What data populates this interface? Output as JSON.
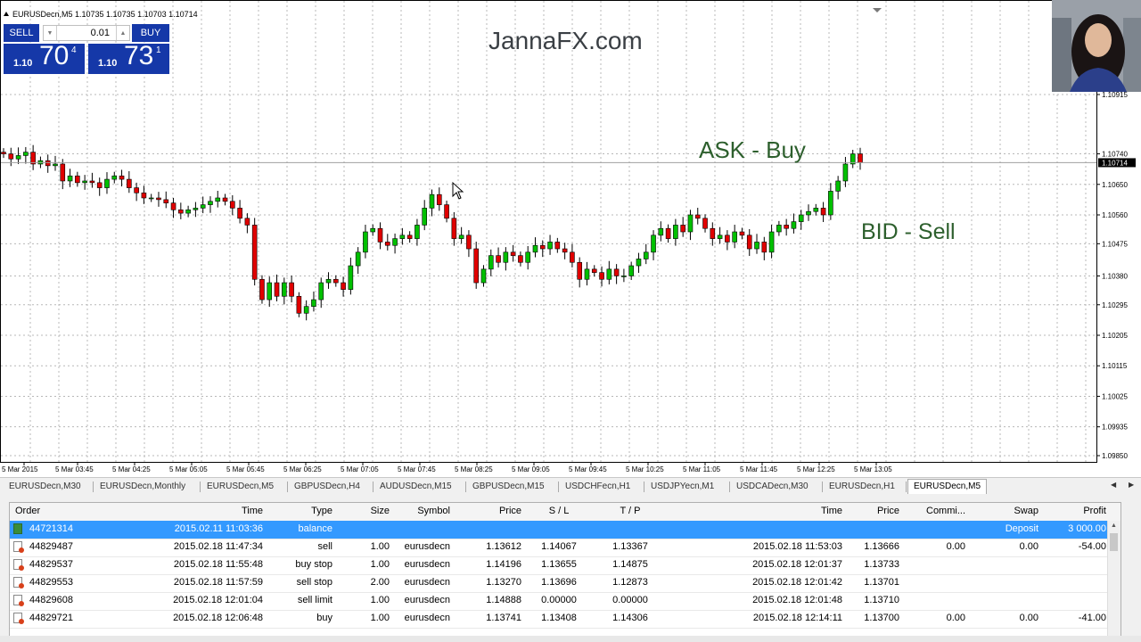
{
  "chart": {
    "title": "EURUSDecn,M5  1.10735 1.10735 1.10703 1.10714",
    "brand": "JannaFX.com",
    "ask_note": "ASK - Buy",
    "bid_note": "BID - Sell",
    "current_price": "1.10714",
    "price_labels": [
      "1.10915",
      "1.10740",
      "1.10650",
      "1.10560",
      "1.10475",
      "1.10380",
      "1.10295",
      "1.10205",
      "1.10115",
      "1.10025",
      "1.09935",
      "1.09850"
    ],
    "time_labels": [
      "5 Mar 2015",
      "5 Mar 03:45",
      "5 Mar 04:25",
      "5 Mar 05:05",
      "5 Mar 05:45",
      "5 Mar 06:25",
      "5 Mar 07:05",
      "5 Mar 07:45",
      "5 Mar 08:25",
      "5 Mar 09:05",
      "5 Mar 09:45",
      "5 Mar 10:25",
      "5 Mar 11:05",
      "5 Mar 11:45",
      "5 Mar 12:25",
      "5 Mar 13:05"
    ],
    "colors": {
      "bull": "#00c000",
      "bear": "#e00000",
      "grid": "#b8b8b8"
    },
    "candles_close": [
      1.1074,
      1.10725,
      1.10735,
      1.10745,
      1.1071,
      1.1072,
      1.10705,
      1.1071,
      1.1066,
      1.10675,
      1.10655,
      1.1066,
      1.10655,
      1.1064,
      1.10665,
      1.10675,
      1.10665,
      1.1064,
      1.10625,
      1.1061,
      1.1061,
      1.10605,
      1.10595,
      1.10575,
      1.10565,
      1.10575,
      1.1058,
      1.1059,
      1.106,
      1.1061,
      1.106,
      1.1058,
      1.1055,
      1.1053,
      1.1037,
      1.1031,
      1.1036,
      1.1032,
      1.1036,
      1.1032,
      1.1027,
      1.1029,
      1.1031,
      1.1036,
      1.1037,
      1.1036,
      1.1034,
      1.1041,
      1.1045,
      1.1051,
      1.1052,
      1.1048,
      1.1047,
      1.1049,
      1.105,
      1.1049,
      1.1053,
      1.1058,
      1.1062,
      1.1059,
      1.1055,
      1.1049,
      1.105,
      1.1046,
      1.1036,
      1.104,
      1.1044,
      1.1042,
      1.1045,
      1.1044,
      1.1042,
      1.1045,
      1.1047,
      1.1046,
      1.1048,
      1.1046,
      1.1045,
      1.1042,
      1.1037,
      1.104,
      1.1039,
      1.1037,
      1.104,
      1.1038,
      1.1038,
      1.1041,
      1.1043,
      1.1045,
      1.105,
      1.1052,
      1.1049,
      1.1053,
      1.1051,
      1.1056,
      1.1055,
      1.1052,
      1.1049,
      1.105,
      1.1048,
      1.1051,
      1.105,
      1.1046,
      1.1048,
      1.1045,
      1.1051,
      1.1053,
      1.1052,
      1.1054,
      1.1056,
      1.1057,
      1.1058,
      1.1056,
      1.1063,
      1.1066,
      1.1071,
      1.1074,
      1.10714
    ]
  },
  "trade_panel": {
    "sell_label": "SELL",
    "buy_label": "BUY",
    "lot": "0.01",
    "bid_prefix": "1.10",
    "bid_big": "70",
    "bid_sup": "4",
    "ask_prefix": "1.10",
    "ask_big": "73",
    "ask_sup": "1"
  },
  "tabs": [
    "EURUSDecn,M30",
    "EURUSDecn,Monthly",
    "EURUSDecn,M5",
    "GBPUSDecn,H4",
    "AUDUSDecn,M15",
    "GBPUSDecn,M15",
    "USDCHFecn,H1",
    "USDJPYecn,M1",
    "USDCADecn,M30",
    "EURUSDecn,H1",
    "EURUSDecn,M5"
  ],
  "active_tab_index": 10,
  "history": {
    "columns": [
      "Order",
      "Time",
      "Type",
      "Size",
      "Symbol",
      "Price",
      "S / L",
      "T / P",
      "Time",
      "Price",
      "Commi...",
      "Swap",
      "Profit"
    ],
    "rows": [
      {
        "order": "44721314",
        "time": "2015.02.11 11:03:36",
        "type": "balance",
        "size": "",
        "symbol": "",
        "price": "",
        "sl": "",
        "tp": "",
        "ctime": "",
        "cprice": "",
        "comm": "",
        "swap": "Deposit",
        "profit": "3 000.00"
      },
      {
        "order": "44829487",
        "time": "2015.02.18 11:47:34",
        "type": "sell",
        "size": "1.00",
        "symbol": "eurusdecn",
        "price": "1.13612",
        "sl": "1.14067",
        "tp": "1.13367",
        "ctime": "2015.02.18 11:53:03",
        "cprice": "1.13666",
        "comm": "0.00",
        "swap": "0.00",
        "profit": "-54.00"
      },
      {
        "order": "44829537",
        "time": "2015.02.18 11:55:48",
        "type": "buy stop",
        "size": "1.00",
        "symbol": "eurusdecn",
        "price": "1.14196",
        "sl": "1.13655",
        "tp": "1.14875",
        "ctime": "2015.02.18 12:01:37",
        "cprice": "1.13733",
        "comm": "",
        "swap": "",
        "profit": ""
      },
      {
        "order": "44829553",
        "time": "2015.02.18 11:57:59",
        "type": "sell stop",
        "size": "2.00",
        "symbol": "eurusdecn",
        "price": "1.13270",
        "sl": "1.13696",
        "tp": "1.12873",
        "ctime": "2015.02.18 12:01:42",
        "cprice": "1.13701",
        "comm": "",
        "swap": "",
        "profit": ""
      },
      {
        "order": "44829608",
        "time": "2015.02.18 12:01:04",
        "type": "sell limit",
        "size": "1.00",
        "symbol": "eurusdecn",
        "price": "1.14888",
        "sl": "0.00000",
        "tp": "0.00000",
        "ctime": "2015.02.18 12:01:48",
        "cprice": "1.13710",
        "comm": "",
        "swap": "",
        "profit": ""
      },
      {
        "order": "44829721",
        "time": "2015.02.18 12:06:48",
        "type": "buy",
        "size": "1.00",
        "symbol": "eurusdecn",
        "price": "1.13741",
        "sl": "1.13408",
        "tp": "1.14306",
        "ctime": "2015.02.18 12:14:11",
        "cprice": "1.13700",
        "comm": "0.00",
        "swap": "0.00",
        "profit": "-41.00"
      }
    ]
  }
}
